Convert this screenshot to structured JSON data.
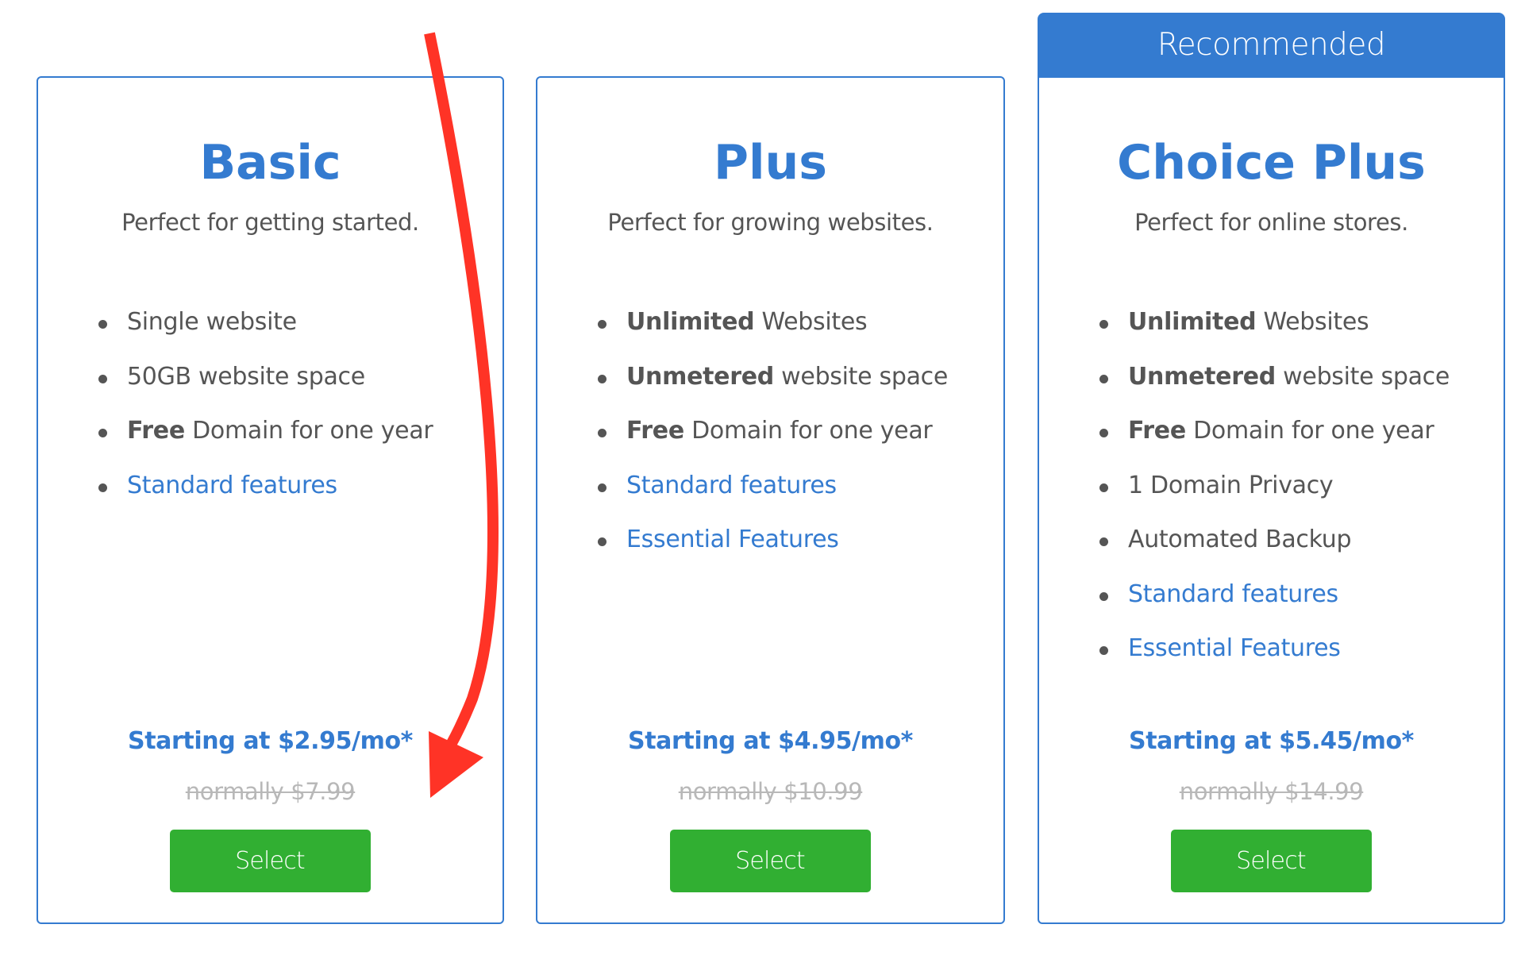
{
  "recommended_label": "Recommended",
  "plans": [
    {
      "name": "Basic",
      "tagline": "Perfect for getting started.",
      "features": [
        {
          "bold": "",
          "text": "Single website",
          "link": false
        },
        {
          "bold": "",
          "text": "50GB website space",
          "link": false
        },
        {
          "bold": "Free",
          "text": " Domain for one year",
          "link": false
        },
        {
          "bold": "",
          "text": "Standard features",
          "link": true
        }
      ],
      "price": "Starting at $2.95/mo*",
      "normal_price": "normally $7.99",
      "button_label": "Select"
    },
    {
      "name": "Plus",
      "tagline": "Perfect for growing websites.",
      "features": [
        {
          "bold": "Unlimited",
          "text": " Websites",
          "link": false
        },
        {
          "bold": "Unmetered",
          "text": " website space",
          "link": false
        },
        {
          "bold": "Free",
          "text": " Domain for one year",
          "link": false
        },
        {
          "bold": "",
          "text": "Standard features",
          "link": true
        },
        {
          "bold": "",
          "text": "Essential Features",
          "link": true
        }
      ],
      "price": "Starting at $4.95/mo*",
      "normal_price": "normally $10.99",
      "button_label": "Select"
    },
    {
      "name": "Choice Plus",
      "tagline": "Perfect for online stores.",
      "features": [
        {
          "bold": "Unlimited",
          "text": " Websites",
          "link": false
        },
        {
          "bold": "Unmetered",
          "text": " website space",
          "link": false
        },
        {
          "bold": "Free",
          "text": " Domain for one year",
          "link": false
        },
        {
          "bold": "",
          "text": "1 Domain Privacy",
          "link": false
        },
        {
          "bold": "",
          "text": "Automated Backup",
          "link": false
        },
        {
          "bold": "",
          "text": "Standard features",
          "link": true
        },
        {
          "bold": "",
          "text": "Essential Features",
          "link": true
        }
      ],
      "price": "Starting at $5.45/mo*",
      "normal_price": "normally $14.99",
      "button_label": "Select"
    }
  ],
  "colors": {
    "brand_blue": "#347bd0",
    "select_green": "#31af32",
    "annotation_red": "#ff3326",
    "strike_gray": "#b8b8b8"
  },
  "annotation": {
    "type": "curved-arrow",
    "points_to": "Basic plan Select button"
  }
}
